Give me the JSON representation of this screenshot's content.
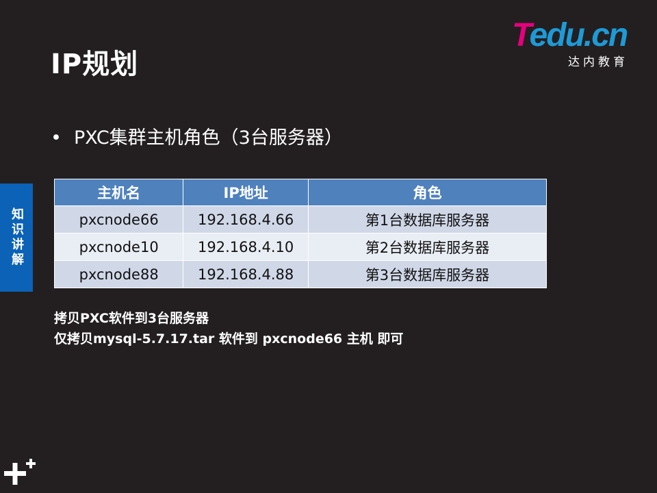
{
  "title": "IP规划",
  "logo": {
    "brand_t": "T",
    "brand_rest": "edu.cn",
    "subtitle": "达内教育"
  },
  "bullet": {
    "marker": "•",
    "text": "PXC集群主机角色（3台服务器）"
  },
  "side_tab": {
    "label": "知识讲解",
    "color": "#0b62b6"
  },
  "table": {
    "headers": [
      "主机名",
      "IP地址",
      "角色"
    ],
    "rows": [
      [
        "pxcnode66",
        "192.168.4.66",
        "第1台数据库服务器"
      ],
      [
        "pxcnode10",
        "192.168.4.10",
        "第2台数据库服务器"
      ],
      [
        "pxcnode88",
        "192.168.4.88",
        "第3台数据库服务器"
      ]
    ],
    "header_color": "#4f81bd"
  },
  "notes": [
    "拷贝PXC软件到3台服务器",
    "仅拷贝mysql-5.7.17.tar 软件到 pxcnode66 主机 即可"
  ],
  "icons": {
    "corner": "plus-icon"
  }
}
